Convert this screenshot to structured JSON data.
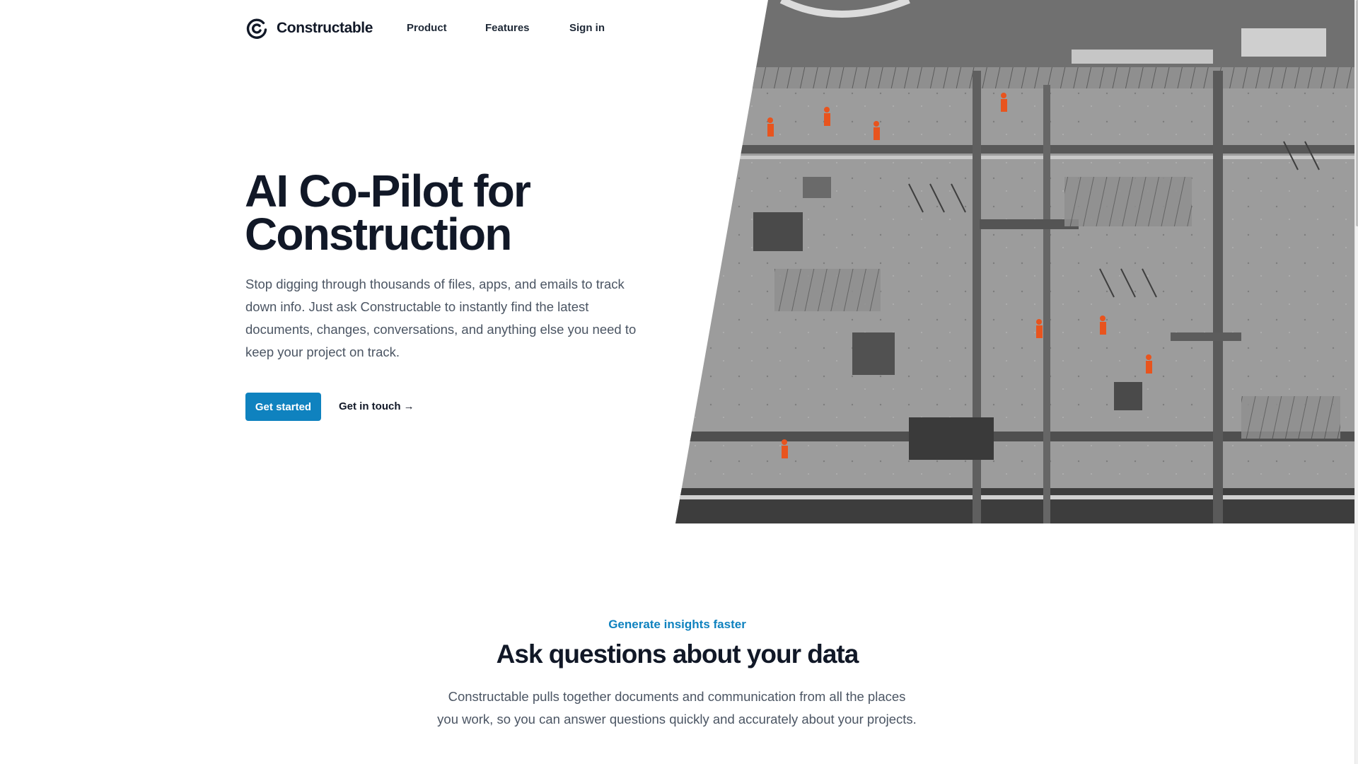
{
  "header": {
    "brand": "Constructable",
    "nav": [
      {
        "label": "Product"
      },
      {
        "label": "Features"
      },
      {
        "label": "Sign in"
      }
    ]
  },
  "hero": {
    "title_line1": "AI Co-Pilot for",
    "title_line2": "Construction",
    "description": "Stop digging through thousands of files, apps, and emails to track down info. Just ask Constructable to instantly find the latest documents, changes, conversations, and anything else you need to keep your project on track.",
    "primary_cta": "Get started",
    "secondary_cta": "Get in touch →"
  },
  "features": {
    "eyebrow": "Generate insights faster",
    "title": "Ask questions about your data",
    "description": "Constructable pulls together documents and communication from all the places you work, so you can answer questions quickly and accurately about your projects."
  },
  "colors": {
    "accent": "#0f82bf",
    "text_dark": "#111827",
    "text_muted": "#4b5563"
  }
}
